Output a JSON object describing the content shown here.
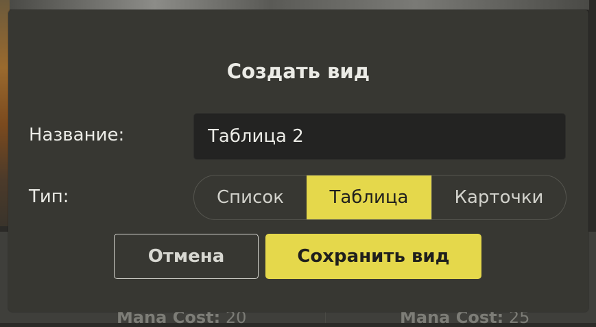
{
  "background": {
    "card_left": {
      "label": "Mana Cost:",
      "value": "20"
    },
    "card_right": {
      "label": "Mana Cost:",
      "value": "25"
    }
  },
  "dialog": {
    "title": "Создать вид",
    "name_label": "Название:",
    "name_value": "Таблица 2",
    "type_label": "Тип:",
    "type_options": [
      "Список",
      "Таблица",
      "Карточки"
    ],
    "type_selected": "Таблица",
    "cancel_label": "Отмена",
    "save_label": "Сохранить вид"
  },
  "colors": {
    "accent": "#e5d84b",
    "dialog_bg": "#373732",
    "input_bg": "#232322",
    "text": "#ebebe6"
  }
}
